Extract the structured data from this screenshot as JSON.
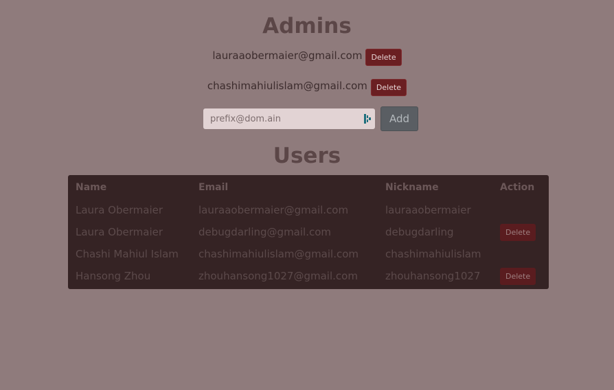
{
  "admins_section": {
    "title": "Admins",
    "admins": [
      {
        "email": "lauraaobermaier@gmail.com",
        "action_label": "Delete"
      },
      {
        "email": "chashimahiulislam@gmail.com",
        "action_label": "Delete"
      }
    ],
    "add_form": {
      "placeholder": "prefix@dom.ain",
      "value": "",
      "button_label": "Add"
    }
  },
  "users_section": {
    "title": "Users",
    "columns": [
      "Name",
      "Email",
      "Nickname",
      "Action"
    ],
    "rows": [
      {
        "name": "Laura Obermaier",
        "email": "lauraaobermaier@gmail.com",
        "nickname": "lauraaobermaier",
        "action": ""
      },
      {
        "name": "Laura Obermaier",
        "email": "debugdarling@gmail.com",
        "nickname": "debugdarling",
        "action": "Delete"
      },
      {
        "name": "Chashi Mahiul Islam",
        "email": "chashimahiulislam@gmail.com",
        "nickname": "chashimahiulislam",
        "action": ""
      },
      {
        "name": "Hansong Zhou",
        "email": "zhouhansong1027@gmail.com",
        "nickname": "zhouhansong1027",
        "action": "Delete"
      }
    ]
  },
  "colors": {
    "background": "#8f7b7c",
    "heading": "#5b4647",
    "delete_button": "#6a1f22",
    "table_background": "#352324",
    "add_button": "#5a5e63"
  },
  "icons": {
    "input_extension": "password-manager-icon"
  }
}
